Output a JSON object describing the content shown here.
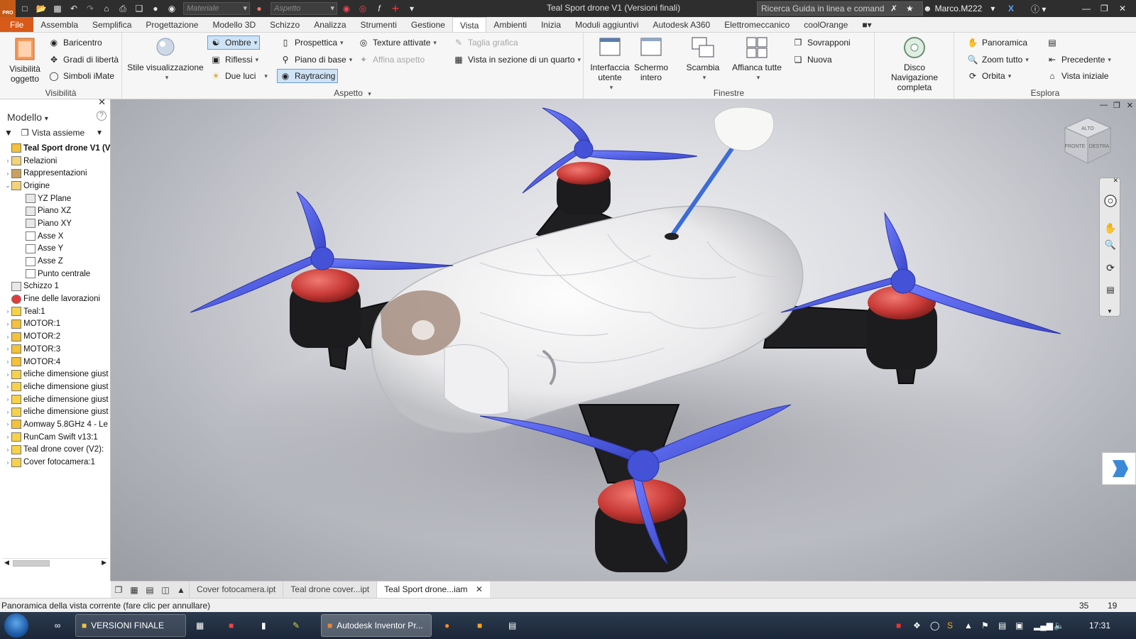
{
  "window": {
    "title": "Teal Sport drone V1 (Versioni finali)",
    "search_placeholder": "Ricerca Guida in linea e comand",
    "user": "Marco.M222",
    "material_combo": "Materiale",
    "appearance_combo": "Aspetto",
    "logo_text": "PRO"
  },
  "menu": {
    "file": "File",
    "tabs": [
      "Assembla",
      "Semplifica",
      "Progettazione",
      "Modello 3D",
      "Schizzo",
      "Analizza",
      "Strumenti",
      "Gestione",
      "Vista",
      "Ambienti",
      "Inizia",
      "Moduli aggiuntivi",
      "Autodesk A360",
      "Elettromeccanico",
      "coolOrange"
    ],
    "active": "Vista"
  },
  "ribbon": {
    "visibilita": {
      "title": "Visibilità",
      "visibilita_oggetto": "Visibilità oggetto",
      "baricentro": "Baricentro",
      "gradi_liberta": "Gradi di libertà",
      "simboli_imate": "Simboli iMate"
    },
    "aspetto": {
      "title": "Aspetto",
      "stile": "Stile visualizzazione",
      "ombre": "Ombre",
      "riflessi": "Riflessi",
      "due_luci": "Due luci",
      "prospettica": "Prospettica",
      "piano_base": "Piano di base",
      "raytracing": "Raytracing",
      "texture": "Texture attivate",
      "affina": "Affina aspetto",
      "taglia": "Taglia grafica",
      "sezione": "Vista in sezione di un quarto"
    },
    "finestre": {
      "title": "Finestre",
      "interfaccia": "Interfaccia utente",
      "schermo": "Schermo intero",
      "scambia": "Scambia",
      "affianca": "Affianca tutte",
      "sovrapponi": "Sovrapponi",
      "nuova": "Nuova"
    },
    "navigazione": {
      "disco": "Disco Navigazione completa"
    },
    "esplora": {
      "title": "Esplora",
      "panoramica": "Panoramica",
      "zoom": "Zoom tutto",
      "orbita": "Orbita",
      "precedente": "Precedente",
      "vista_iniziale": "Vista iniziale"
    }
  },
  "browser": {
    "title": "Modello",
    "view_mode": "Vista assieme",
    "items": [
      {
        "label": "Teal Sport drone V1 (V",
        "level": 0,
        "exp": "",
        "icon": "assembly-icon",
        "bold": true
      },
      {
        "label": "Relazioni",
        "level": 1,
        "exp": "›",
        "icon": "folder-icon"
      },
      {
        "label": "Rappresentazioni",
        "level": 1,
        "exp": "›",
        "icon": "representations-icon"
      },
      {
        "label": "Origine",
        "level": 1,
        "exp": "⌄",
        "icon": "folder-icon"
      },
      {
        "label": "YZ Plane",
        "level": 2,
        "exp": "",
        "icon": "plane-icon"
      },
      {
        "label": "Piano XZ",
        "level": 2,
        "exp": "",
        "icon": "plane-icon"
      },
      {
        "label": "Piano XY",
        "level": 2,
        "exp": "",
        "icon": "plane-icon"
      },
      {
        "label": "Asse X",
        "level": 2,
        "exp": "",
        "icon": "axis-icon"
      },
      {
        "label": "Asse Y",
        "level": 2,
        "exp": "",
        "icon": "axis-icon"
      },
      {
        "label": "Asse Z",
        "level": 2,
        "exp": "",
        "icon": "axis-icon"
      },
      {
        "label": "Punto centrale",
        "level": 2,
        "exp": "",
        "icon": "point-icon"
      },
      {
        "label": "Schizzo 1",
        "level": 1,
        "exp": "",
        "icon": "sketch-icon"
      },
      {
        "label": "Fine delle lavorazioni",
        "level": 1,
        "exp": "",
        "icon": "end-of-features-icon"
      },
      {
        "label": "Teal:1",
        "level": 1,
        "exp": "›",
        "icon": "part-icon"
      },
      {
        "label": "MOTOR:1",
        "level": 1,
        "exp": "›",
        "icon": "subassembly-icon"
      },
      {
        "label": "MOTOR:2",
        "level": 1,
        "exp": "›",
        "icon": "subassembly-icon"
      },
      {
        "label": "MOTOR:3",
        "level": 1,
        "exp": "›",
        "icon": "subassembly-icon"
      },
      {
        "label": "MOTOR:4",
        "level": 1,
        "exp": "›",
        "icon": "subassembly-icon"
      },
      {
        "label": "eliche dimensione giust",
        "level": 1,
        "exp": "›",
        "icon": "part-icon"
      },
      {
        "label": "eliche dimensione giust",
        "level": 1,
        "exp": "›",
        "icon": "part-icon"
      },
      {
        "label": "eliche dimensione giust",
        "level": 1,
        "exp": "›",
        "icon": "part-icon"
      },
      {
        "label": "eliche dimensione giust",
        "level": 1,
        "exp": "›",
        "icon": "part-icon"
      },
      {
        "label": "Aomway 5.8GHz 4 - Le",
        "level": 1,
        "exp": "›",
        "icon": "subassembly-icon"
      },
      {
        "label": "RunCam Swift v13:1",
        "level": 1,
        "exp": "›",
        "icon": "part-icon"
      },
      {
        "label": "Teal drone cover (V2):",
        "level": 1,
        "exp": "›",
        "icon": "part-icon"
      },
      {
        "label": "Cover fotocamera:1",
        "level": 1,
        "exp": "›",
        "icon": "part-icon"
      }
    ]
  },
  "viewcube": {
    "top": "ALTO",
    "front": "FRONTE",
    "right": "DESTRA"
  },
  "doc_tabs": [
    {
      "label": "Cover fotocamera.ipt",
      "active": false
    },
    {
      "label": "Teal drone cover...ipt",
      "active": false
    },
    {
      "label": "Teal Sport drone...iam",
      "active": true
    }
  ],
  "status": {
    "text": "Panoramica della vista corrente (fare clic per annullare)",
    "num1": "35",
    "num2": "19"
  },
  "taskbar": {
    "app1": "VERSIONI FINALE",
    "app2": "Autodesk Inventor Pr...",
    "clock": "17:31"
  },
  "colors": {
    "file_tab": "#d85a18",
    "propeller": "#5566e8",
    "motor": "#d94a4a",
    "frame": "#1e1e1e",
    "body": "#f4f4f4"
  }
}
